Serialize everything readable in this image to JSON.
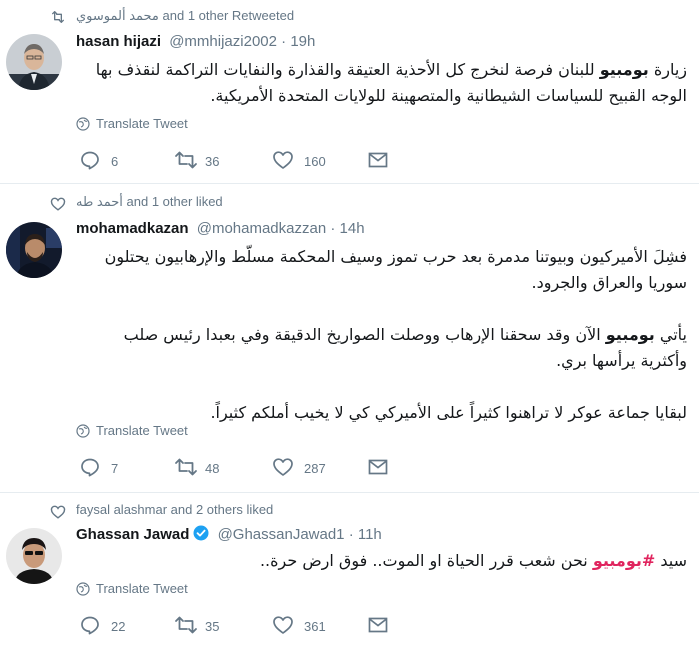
{
  "tweets": [
    {
      "context": {
        "icon": "retweet-icon",
        "text": "محمد ألموسوي and 1 other Retweeted"
      },
      "author": {
        "name": "hasan hijazi",
        "handle": "@mmhijazi2002",
        "time": "· 19h",
        "verified": false
      },
      "lines": [
        [
          {
            "t": "زيارة "
          },
          {
            "t": "بومبيو",
            "style": "bold"
          },
          {
            "t": " للبنان فرصة لنخرج كل الأحذية العتيقة والقذارة والنفايات التراكمة لنقذف بها"
          }
        ],
        [
          {
            "t": "الوجه القبيح للسياسات الشيطانية والمتصهينة للولايات المتحدة الأمريكية."
          }
        ]
      ],
      "translate": "Translate Tweet",
      "counts": {
        "replies": "6",
        "retweets": "36",
        "likes": "160"
      }
    },
    {
      "context": {
        "icon": "heart-icon",
        "text": "أحمد طه and 1 other liked"
      },
      "author": {
        "name": "mohamadkazan",
        "handle": "@mohamadkazzan",
        "time": "· 14h",
        "verified": false
      },
      "lines": [
        [
          {
            "t": "فشِلَ الأميركيون وبيوتنا مدمرة بعد حرب تموز وسيف المحكمة مسلّط والإرهابيون يحتلون"
          }
        ],
        [
          {
            "t": "سوريا والعراق والجرود."
          }
        ],
        [
          {
            "t": ""
          }
        ],
        [
          {
            "t": "يأتي "
          },
          {
            "t": "بومبيو",
            "style": "bold"
          },
          {
            "t": " الآن وقد سحقنا الإرهاب ووصلت الصواريخ الدقيقة وفي بعبدا رئيس صلب"
          }
        ],
        [
          {
            "t": "وأكثرية يرأسها بري."
          }
        ],
        [
          {
            "t": ""
          }
        ],
        [
          {
            "t": "لبقايا جماعة عوكر لا تراهنوا كثيراً على الأميركي كي لا يخيب أملكم كثيراً."
          }
        ]
      ],
      "translate": "Translate Tweet",
      "counts": {
        "replies": "7",
        "retweets": "48",
        "likes": "287"
      }
    },
    {
      "context": {
        "icon": "heart-icon",
        "text": "faysal alashmar and 2 others liked"
      },
      "author": {
        "name": "Ghassan Jawad",
        "handle": "@GhassanJawad1",
        "time": "· 11h",
        "verified": true
      },
      "lines": [
        [
          {
            "t": "سيد "
          },
          {
            "t": "#بومبيو",
            "style": "hash"
          },
          {
            "t": " نحن شعب قرر الحياة او الموت.. فوق ارض حرة.."
          }
        ]
      ],
      "translate": "Translate Tweet",
      "counts": {
        "replies": "22",
        "retweets": "35",
        "likes": "361"
      }
    }
  ],
  "colors": {
    "muted": "#657786",
    "text": "#14171a",
    "hashtag": "#e0245e",
    "verified": "#1da1f2",
    "divider": "#e6ecf0"
  }
}
